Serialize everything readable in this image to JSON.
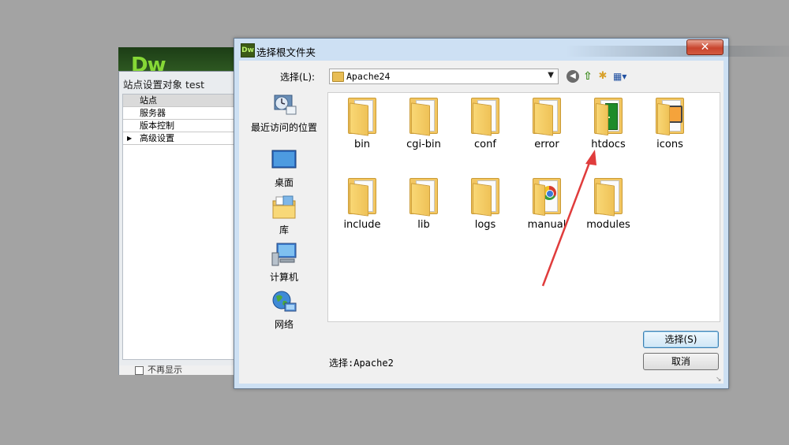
{
  "background_app": {
    "logo": "Dw",
    "site_dialog": {
      "title": "站点设置对象 test",
      "nav_items": [
        {
          "label": "站点",
          "selected": true,
          "expandable": false
        },
        {
          "label": "服务器",
          "selected": false,
          "expandable": false
        },
        {
          "label": "版本控制",
          "selected": false,
          "expandable": false
        },
        {
          "label": "高级设置",
          "selected": false,
          "expandable": true
        }
      ],
      "bottom_checkbox_label": "不再显示"
    }
  },
  "dialog": {
    "icon": "Dw",
    "title": "选择根文件夹",
    "close_label": "✕",
    "lookin_label": "选择(L):",
    "current_folder": "Apache24",
    "toolbar_icons": [
      "back-icon",
      "up-folder-icon",
      "new-folder-icon",
      "view-menu-icon"
    ],
    "places": [
      {
        "label": "最近访问的位置",
        "icon": "recent-places-icon"
      },
      {
        "label": "桌面",
        "icon": "desktop-icon"
      },
      {
        "label": "库",
        "icon": "libraries-icon"
      },
      {
        "label": "计算机",
        "icon": "computer-icon"
      },
      {
        "label": "网络",
        "icon": "network-icon"
      }
    ],
    "folders": [
      {
        "name": "bin",
        "overlay": "none"
      },
      {
        "name": "cgi-bin",
        "overlay": "none"
      },
      {
        "name": "conf",
        "overlay": "none"
      },
      {
        "name": "error",
        "overlay": "none"
      },
      {
        "name": "htdocs",
        "overlay": "door"
      },
      {
        "name": "icons",
        "overlay": "picture"
      },
      {
        "name": "include",
        "overlay": "none"
      },
      {
        "name": "lib",
        "overlay": "none"
      },
      {
        "name": "logs",
        "overlay": "none"
      },
      {
        "name": "manual",
        "overlay": "chrome"
      },
      {
        "name": "modules",
        "overlay": "none"
      }
    ],
    "selection_text": "选择:Apache2",
    "select_button": "选择(S)",
    "cancel_button": "取消"
  },
  "annotation_color": "#e03c3c"
}
